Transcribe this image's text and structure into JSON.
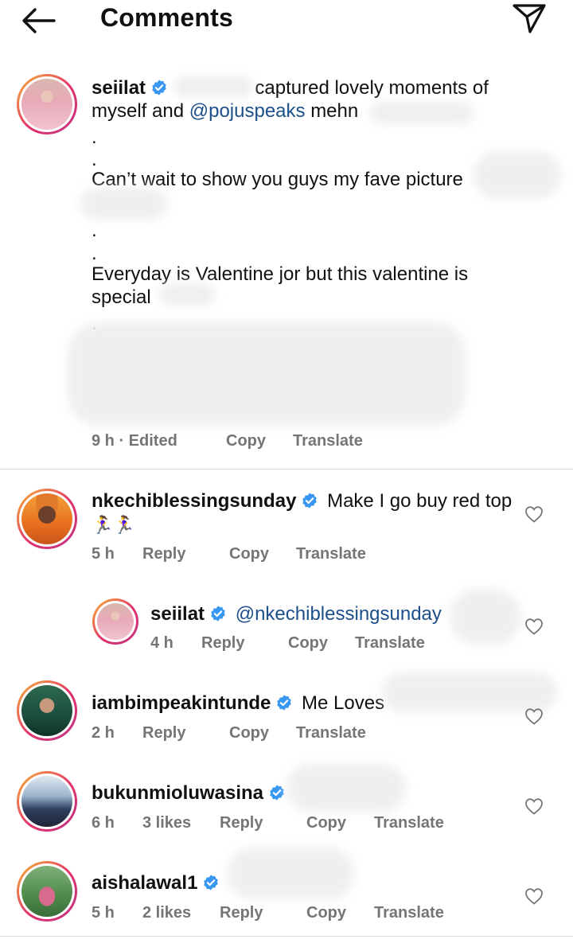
{
  "header": {
    "title": "Comments"
  },
  "caption": {
    "username": "seiilat",
    "line1": "captured lovely moments of",
    "line2_prefix": "myself and",
    "line2_mention": "@pojuspeaks",
    "line2_suffix": "mehn",
    "dot1": ".",
    "dot2": ".",
    "line3": "Can’t wait to show you guys my fave picture",
    "dot3": ".",
    "dot4": ".",
    "line4": "Everyday is Valentine jor but this valentine is",
    "line5": "special",
    "dot5": ".",
    "meta": {
      "time": "9 h · Edited",
      "copy": "Copy",
      "translate": "Translate"
    }
  },
  "comments": [
    {
      "username": "nkechiblessingsunday",
      "text": "Make I go buy red top",
      "emoji": "🏃‍♀️🏃‍♀️",
      "meta": {
        "time": "5 h",
        "reply": "Reply",
        "copy": "Copy",
        "translate": "Translate"
      },
      "icon": "heart-outline-icon"
    },
    {
      "username": "seiilat",
      "mention": "@nkechiblessingsunday",
      "meta": {
        "time": "4 h",
        "reply": "Reply",
        "copy": "Copy",
        "translate": "Translate"
      },
      "icon": "heart-outline-icon"
    },
    {
      "username": "iambimpeakintunde",
      "text": "Me Loves",
      "meta": {
        "time": "2 h",
        "reply": "Reply",
        "copy": "Copy",
        "translate": "Translate"
      },
      "icon": "heart-outline-icon"
    },
    {
      "username": "bukunmioluwasina",
      "meta": {
        "time": "6 h",
        "likes": "3 likes",
        "reply": "Reply",
        "copy": "Copy",
        "translate": "Translate"
      },
      "icon": "heart-outline-icon"
    },
    {
      "username": "aishalawal1",
      "meta": {
        "time": "5 h",
        "likes": "2 likes",
        "reply": "Reply",
        "copy": "Copy",
        "translate": "Translate"
      },
      "icon": "heart-outline-icon"
    }
  ],
  "colors": {
    "mention": "#1d4f8a",
    "meta_gray": "#757575",
    "verified_blue": "#3897f0",
    "story_ring_start": "#f7b733",
    "story_ring_end": "#c13584"
  }
}
